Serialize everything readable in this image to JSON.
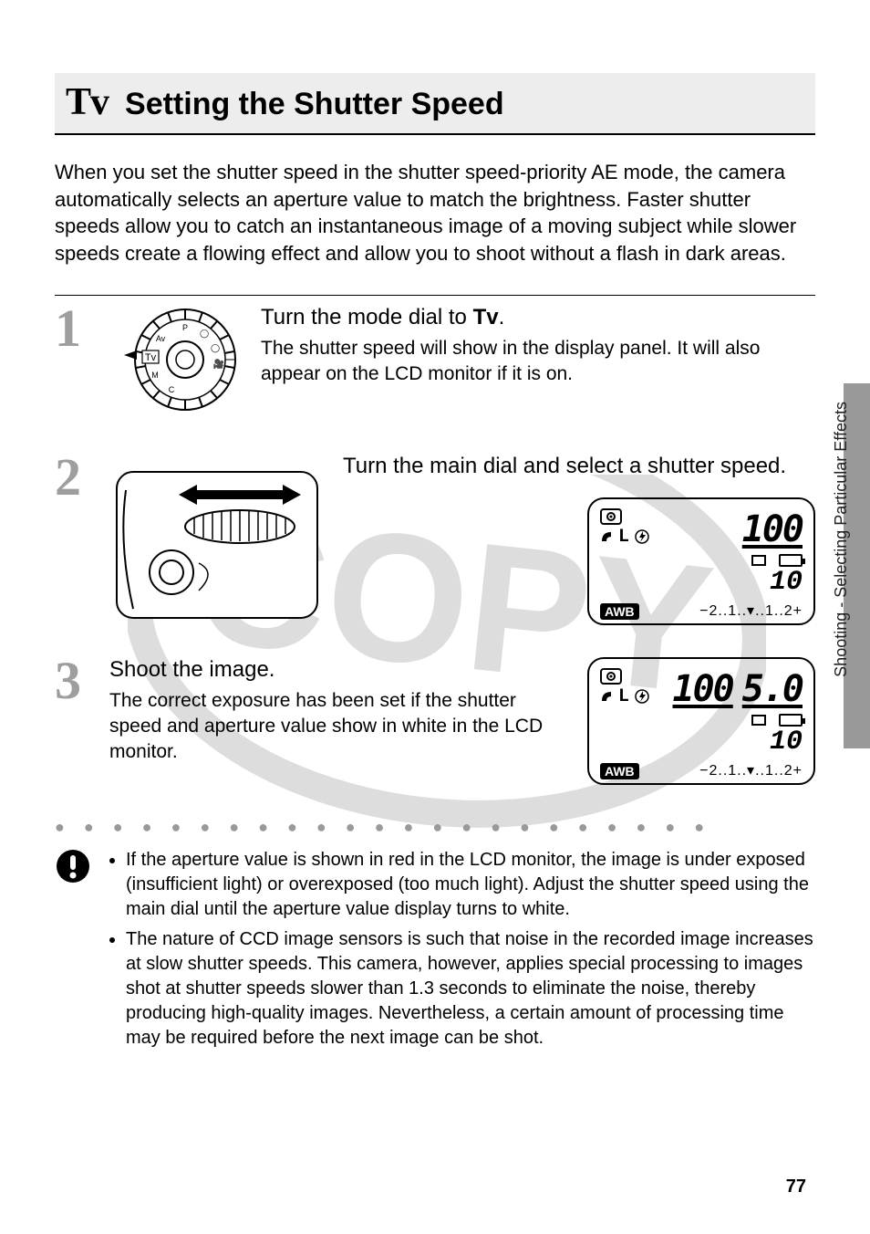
{
  "sideTab": "Shooting - Selecting Particular Effects",
  "header": {
    "modeIcon": "Tv",
    "title": "Setting the Shutter Speed"
  },
  "intro": "When you set the shutter speed in the shutter speed-priority AE mode, the camera automatically selects an aperture value to match the brightness. Faster shutter speeds allow you to catch an instantaneous image of a moving subject while slower speeds create a flowing effect and allow you to shoot without a flash in dark areas.",
  "steps": [
    {
      "num": "1",
      "titlePrefix": "Turn the mode dial to ",
      "titleBold": "Tv",
      "titleSuffix": ".",
      "desc": "The shutter speed will show in the display panel. It will also appear on the LCD monitor if it is on.",
      "dialLabel": "Tv"
    },
    {
      "num": "2",
      "title": "Turn the main dial and select a shutter speed.",
      "panel": {
        "shutter": "100",
        "aperture": "",
        "size": "L",
        "awb": "AWB",
        "shots": "10",
        "ev": "−2..1..▾..1..2+"
      }
    },
    {
      "num": "3",
      "title": "Shoot the image.",
      "desc": "The correct exposure has been set if the shutter speed and aperture value show in white in the LCD monitor.",
      "panel": {
        "shutter": "100",
        "aperture": "5.0",
        "size": "L",
        "awb": "AWB",
        "shots": "10",
        "ev": "−2..1..▾..1..2+"
      }
    }
  ],
  "notes": [
    "If the aperture value is shown in red in the LCD monitor, the image is under exposed (insufficient light) or overexposed (too much light). Adjust the shutter speed using the main dial until the aperture value display turns to white.",
    "The nature of CCD image sensors is such that noise in the recorded image increases at slow shutter speeds. This camera, however, applies special processing to images shot at shutter speeds slower than 1.3 seconds to eliminate the noise, thereby producing high-quality images. Nevertheless, a certain amount of processing time may be required before the next image can be shot."
  ],
  "watermark": "COPY",
  "pageNumber": "77"
}
